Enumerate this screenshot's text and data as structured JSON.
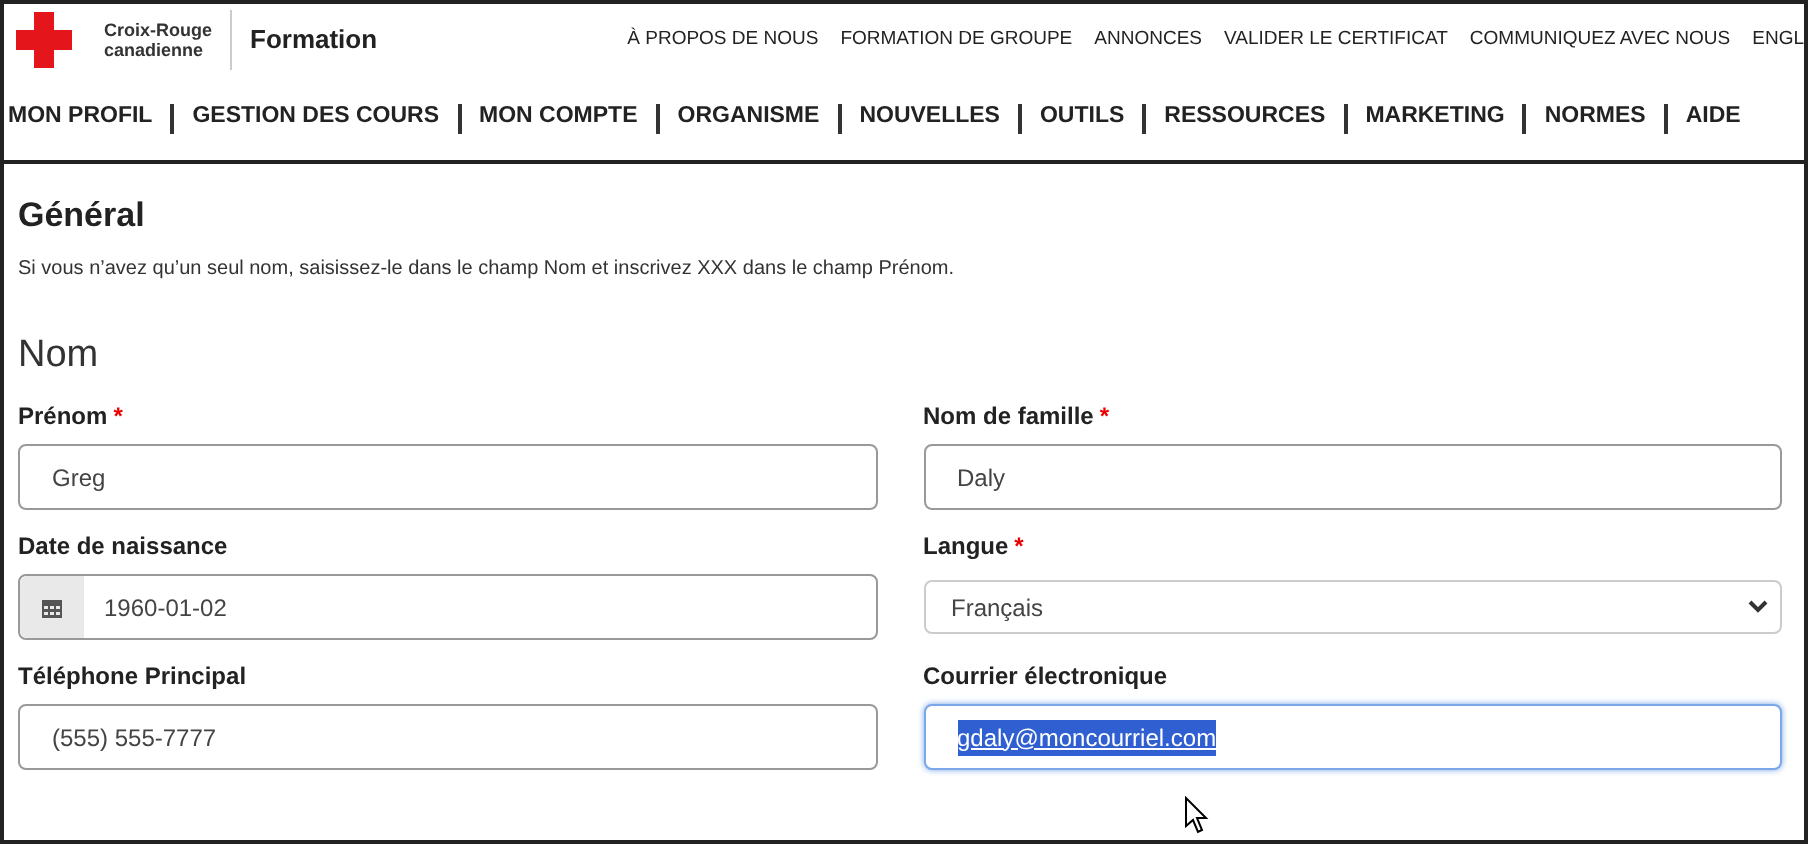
{
  "brand": {
    "line1": "Croix-Rouge",
    "line2": "canadienne",
    "product": "Formation"
  },
  "top_links": [
    "À PROPOS DE NOUS",
    "FORMATION DE GROUPE",
    "ANNONCES",
    "VALIDER LE CERTIFICAT",
    "COMMUNIQUEZ AVEC NOUS",
    "ENGL"
  ],
  "nav": [
    "MON PROFIL",
    "GESTION DES COURS",
    "MON COMPTE",
    "ORGANISME",
    "NOUVELLES",
    "OUTILS",
    "RESSOURCES",
    "MARKETING",
    "NORMES",
    "AIDE"
  ],
  "section": {
    "title": "Général",
    "note": "Si vous n’avez qu’un seul nom, saisissez-le dans le champ Nom et inscrivez XXX dans le champ Prénom."
  },
  "group_title": "Nom",
  "fields": [
    {
      "kind": "text",
      "label": "Prénom",
      "required_mark": "*",
      "value": "Greg",
      "focused": false,
      "text_selected": false
    },
    {
      "kind": "text",
      "label": "Nom de famille",
      "required_mark": "*",
      "value": "Daly",
      "focused": false,
      "text_selected": false
    },
    {
      "kind": "date",
      "label": "Date de naissance",
      "value": "1960-01-02",
      "focused": false,
      "text_selected": false
    },
    {
      "kind": "select",
      "label": "Langue",
      "required_mark": "*",
      "value": "Français",
      "focused": false,
      "text_selected": false
    },
    {
      "kind": "text",
      "label": "Téléphone Principal",
      "value": "(555) 555-7777",
      "focused": false,
      "text_selected": false
    },
    {
      "kind": "text",
      "label": "Courrier électronique",
      "value": "gdaly@moncourriel.com",
      "focused": true,
      "text_selected": true
    }
  ]
}
